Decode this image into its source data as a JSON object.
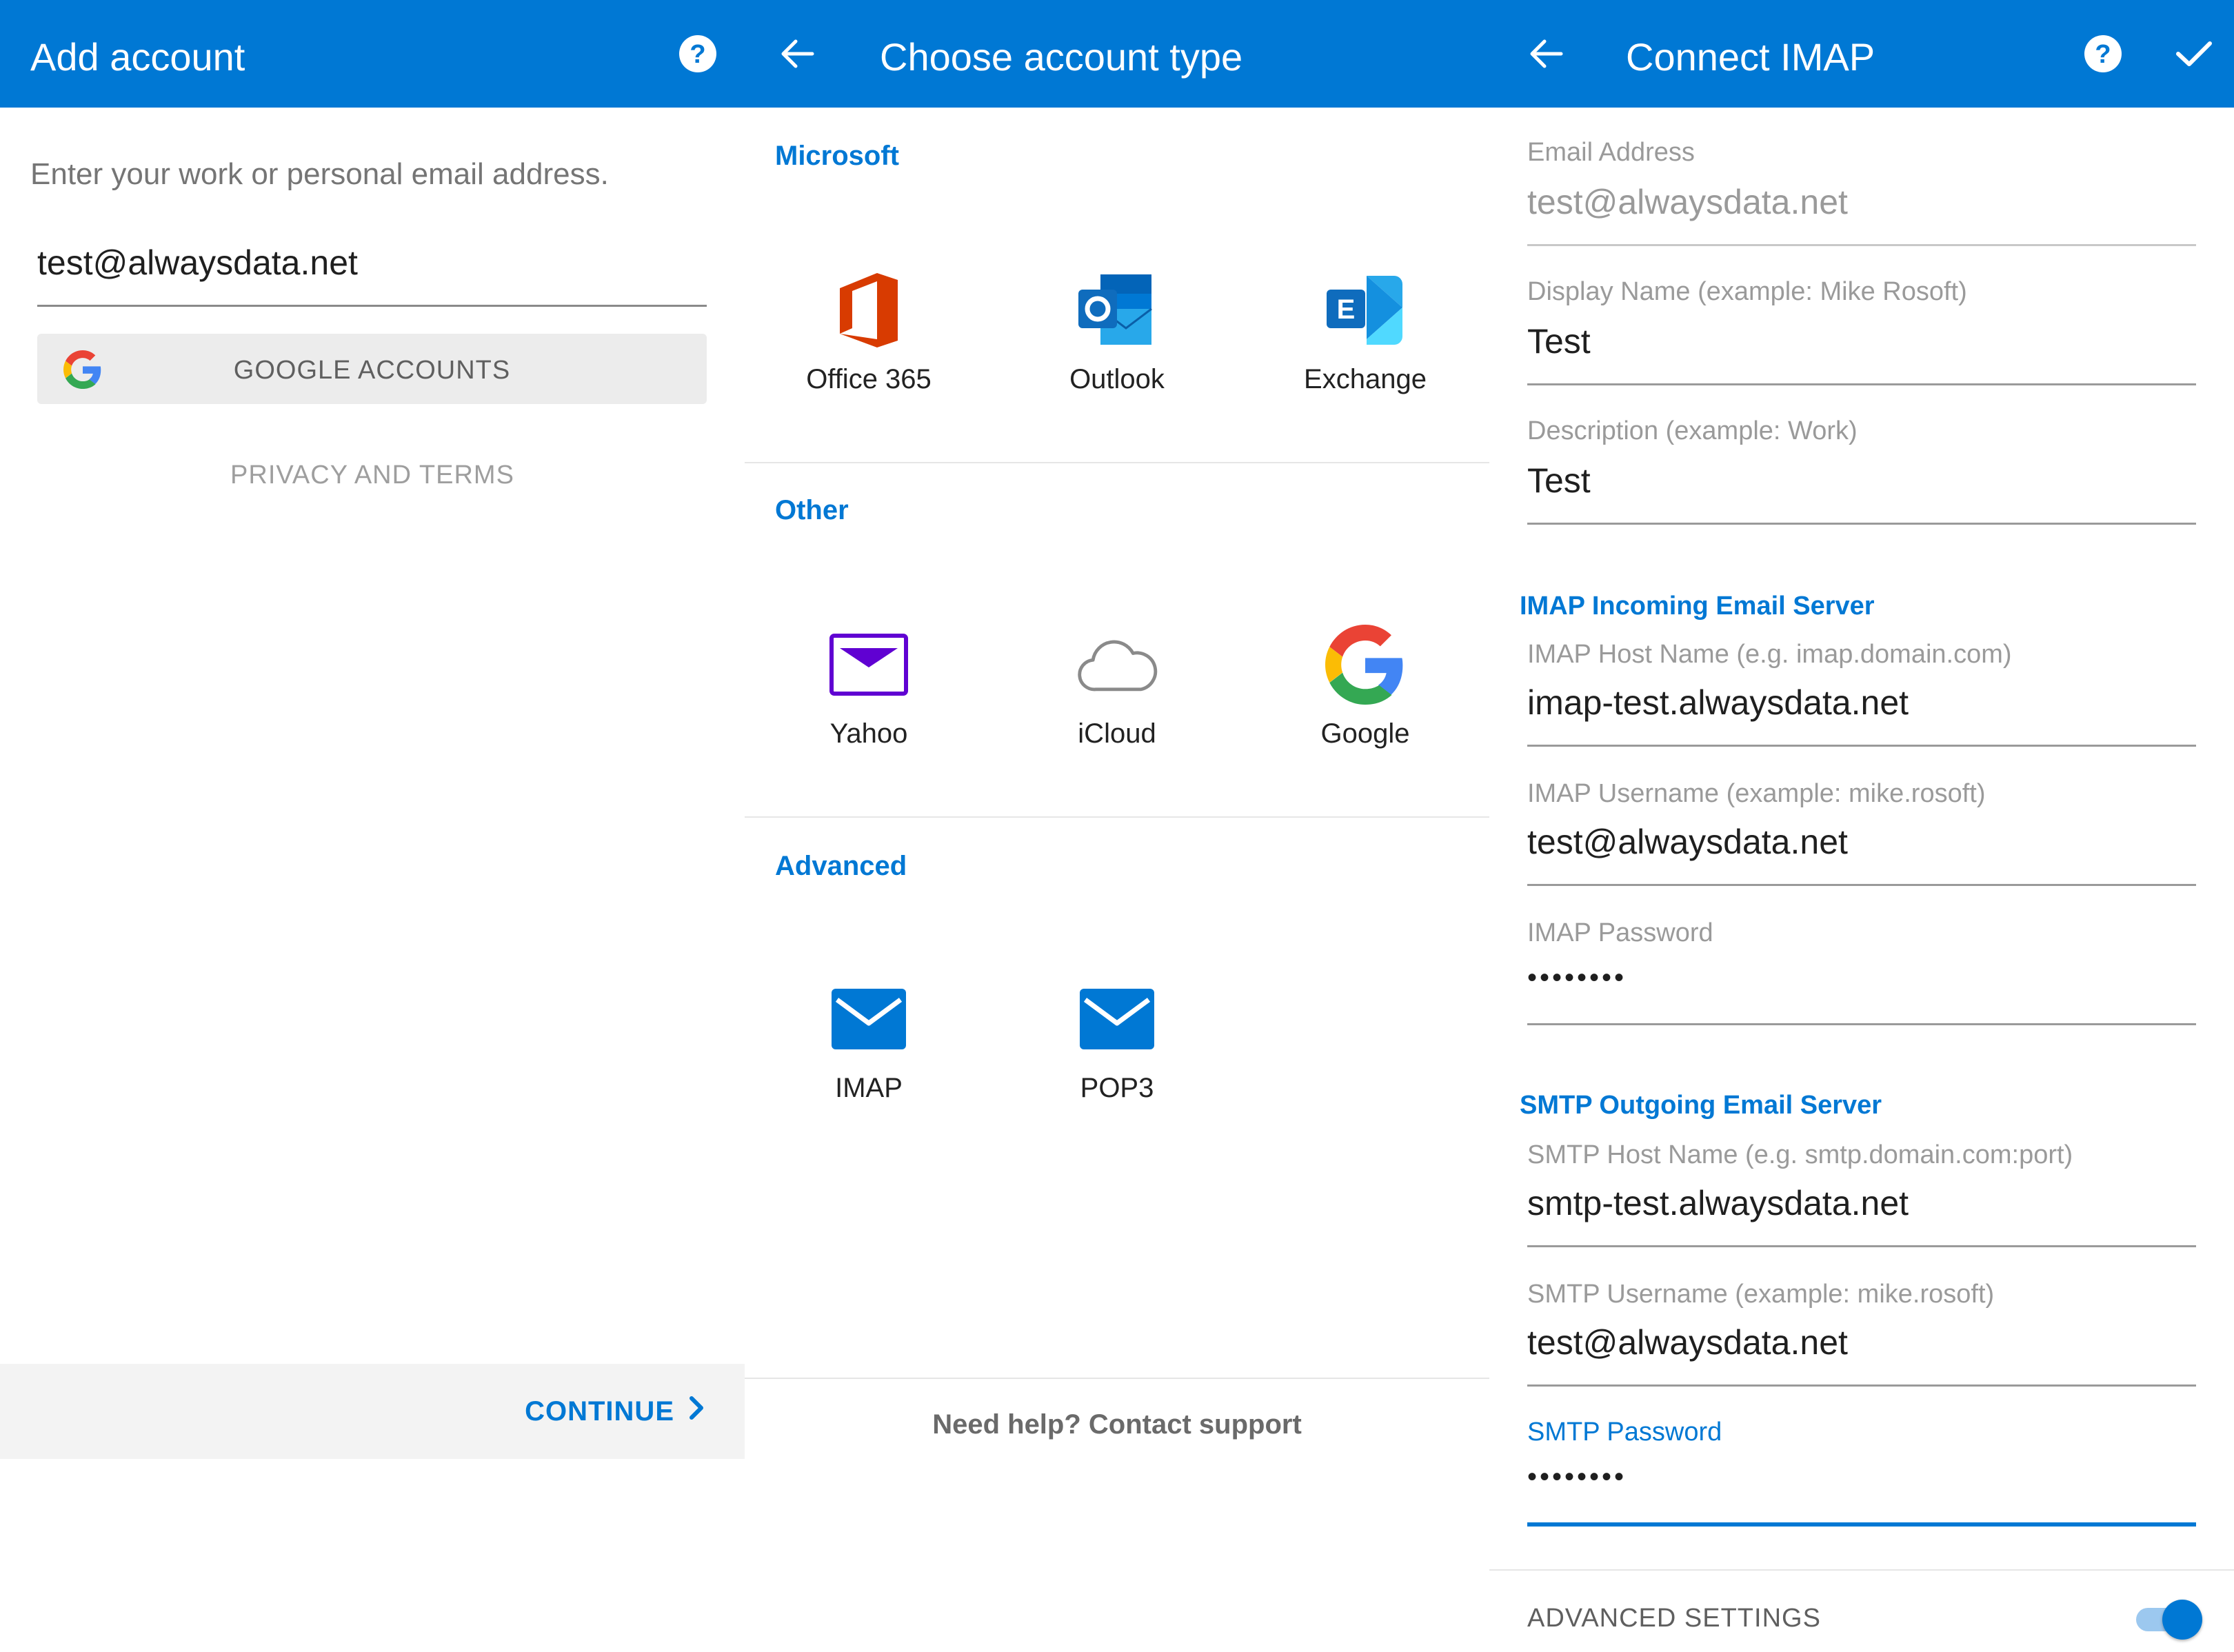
{
  "add_account": {
    "title": "Add account",
    "help_icon": "help-circle-icon",
    "hint": "Enter your work or personal email address.",
    "email_value": "test@alwaysdata.net",
    "google_button": "GOOGLE ACCOUNTS",
    "privacy": "PRIVACY AND TERMS",
    "continue": "CONTINUE"
  },
  "choose_type": {
    "title": "Choose account type",
    "sections": {
      "microsoft": "Microsoft",
      "other": "Other",
      "advanced": "Advanced"
    },
    "tiles": {
      "office365": "Office 365",
      "outlook": "Outlook",
      "exchange": "Exchange",
      "yahoo": "Yahoo",
      "icloud": "iCloud",
      "google": "Google",
      "imap": "IMAP",
      "pop3": "POP3"
    },
    "help": "Need help? Contact support"
  },
  "connect_imap": {
    "title": "Connect IMAP",
    "email_label": "Email Address",
    "email_value": "test@alwaysdata.net",
    "display_label": "Display Name (example: Mike Rosoft)",
    "display_value": "Test",
    "desc_label": "Description (example: Work)",
    "desc_value": "Test",
    "imap_heading": "IMAP Incoming Email Server",
    "imap_host_label": "IMAP Host Name (e.g. imap.domain.com)",
    "imap_host_value": "imap-test.alwaysdata.net",
    "imap_user_label": "IMAP Username (example: mike.rosoft)",
    "imap_user_value": "test@alwaysdata.net",
    "imap_pass_label": "IMAP Password",
    "imap_pass_value": "••••••••",
    "smtp_heading": "SMTP Outgoing Email Server",
    "smtp_host_label": "SMTP Host Name (e.g. smtp.domain.com:port)",
    "smtp_host_value": "smtp-test.alwaysdata.net",
    "smtp_user_label": "SMTP Username (example: mike.rosoft)",
    "smtp_user_value": "test@alwaysdata.net",
    "smtp_pass_label": "SMTP Password",
    "smtp_pass_value": "••••••••",
    "advanced_settings": "ADVANCED SETTINGS",
    "advanced_settings_on": true
  },
  "colors": {
    "brand": "#0078d4",
    "toggle_track": "#9cc8ef",
    "office_red": "#d83b01",
    "yahoo_purple": "#6001d2"
  }
}
